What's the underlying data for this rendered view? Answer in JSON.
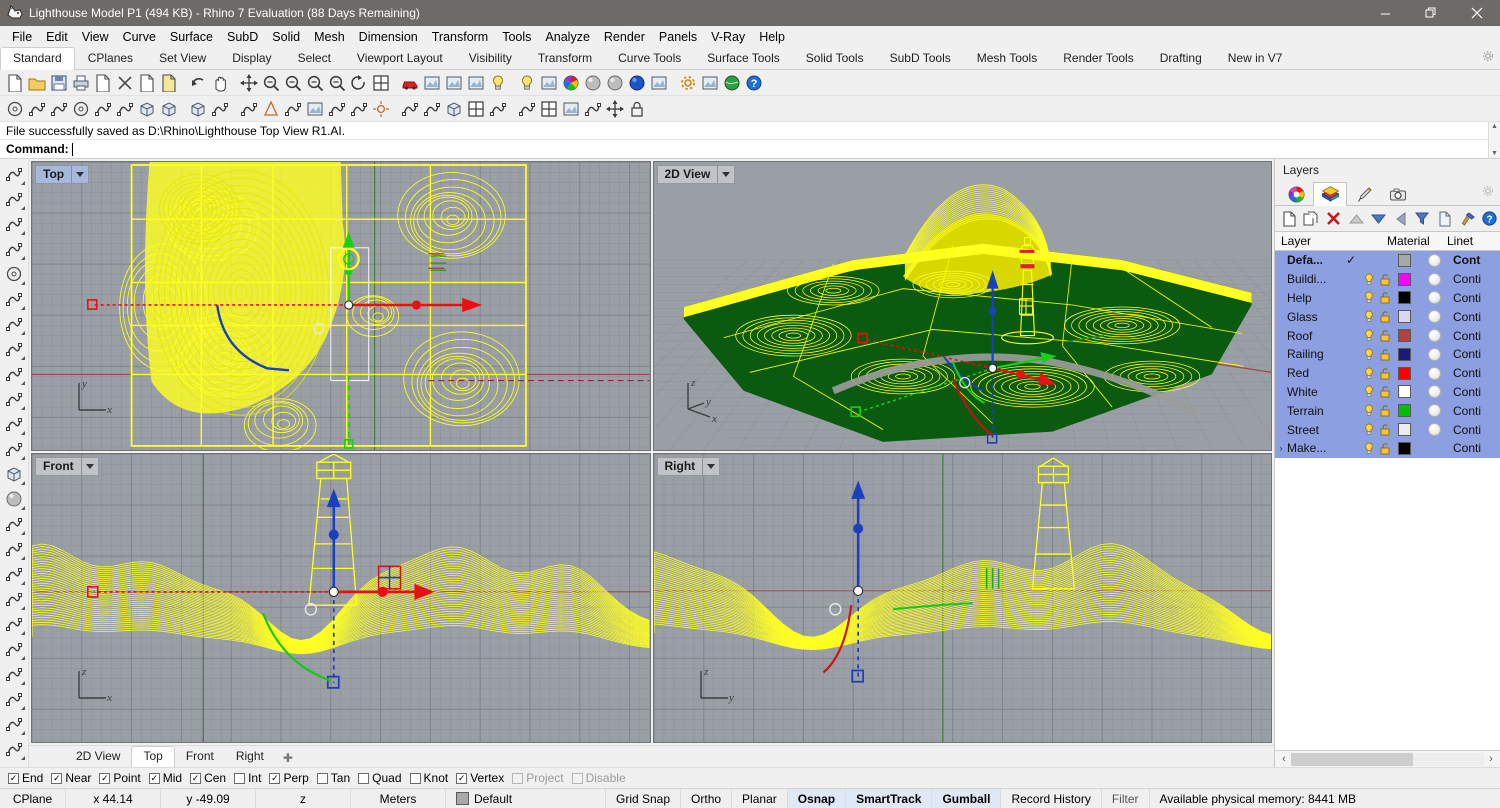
{
  "titlebar": {
    "text": "Lighthouse Model P1 (494 KB) - Rhino 7 Evaluation (88 Days Remaining)",
    "minimize": "—",
    "maximize": "❐",
    "close": "✕",
    "app_icon": "rhino-logo-icon"
  },
  "menu": [
    "File",
    "Edit",
    "View",
    "Curve",
    "Surface",
    "SubD",
    "Solid",
    "Mesh",
    "Dimension",
    "Transform",
    "Tools",
    "Analyze",
    "Render",
    "Panels",
    "V-Ray",
    "Help"
  ],
  "tabs": {
    "items": [
      "Standard",
      "CPlanes",
      "Set View",
      "Display",
      "Select",
      "Viewport Layout",
      "Visibility",
      "Transform",
      "Curve Tools",
      "Surface Tools",
      "Solid Tools",
      "SubD Tools",
      "Mesh Tools",
      "Render Tools",
      "Drafting",
      "New in V7"
    ],
    "active": "Standard"
  },
  "toolbar_row1": [
    "new-file-icon",
    "open-folder-icon",
    "save-icon",
    "print-icon",
    "cut-copy-icon",
    "delete-x-icon",
    "copy-icon",
    "paste-icon",
    "undo-arrow-icon",
    "pan-hand-icon",
    "move-icon",
    "zoom-in-icon",
    "zoom-window-icon",
    "zoom-extents-icon",
    "zoom-selected-icon",
    "rotate-view-icon",
    "four-view-icon",
    "car-render-icon",
    "render-preview-icon",
    "shade-icon",
    "named-view-icon",
    "light-bulb-icon",
    "spotlight-icon",
    "material-paint-icon",
    "color-wheel-icon",
    "sphere-gray-icon",
    "sphere-shaded-icon",
    "sphere-blue-icon",
    "ray-trace-icon",
    "settings-gear-icon",
    "explode-icon",
    "earth-render-icon",
    "help-icon"
  ],
  "toolbar_row2": [
    "curve-circle-icon",
    "curve-spiral-icon",
    "arc-icon",
    "arc-shaded-icon",
    "revolve-icon",
    "sweep-icon",
    "box-front-icon",
    "box-side-icon",
    "box-new-icon",
    "extrude-icon",
    "loft-icon",
    "cone-icon",
    "pipe-icon",
    "explode-star-icon",
    "blend-icon",
    "offset-surface-icon",
    "sun-icon",
    "lines-icon",
    "mesh-icon",
    "box-corner-icon",
    "box-edit-icon",
    "boolean-icon",
    "trim-icon",
    "grid-icon",
    "analyze-icon",
    "section-icon",
    "center-icon",
    "lock-object-icon"
  ],
  "command": {
    "history": "File successfully saved as D:\\Rhino\\Lighthouse Top View R1.AI.",
    "prompt": "Command:",
    "value": ""
  },
  "left_toolbar": [
    "select-arrow-icon",
    "point-icon",
    "polyline-icon",
    "control-point-curve-icon",
    "circle-icon",
    "ellipse-icon",
    "arc-icon",
    "rectangle-icon",
    "polygon-icon",
    "blend-curve-icon",
    "surface-points-icon",
    "surface-curve-icon",
    "box-solid-icon",
    "sphere-solid-icon",
    "mesh-tools-icon",
    "text-icon",
    "dimension-icon",
    "hatch-icon",
    "layer-icon",
    "transform-icon",
    "array-icon",
    "fillet-icon",
    "trim-icon",
    "split-icon",
    "analyze-icon"
  ],
  "viewports": [
    {
      "name": "Top",
      "active": true,
      "axis": [
        "y",
        "x"
      ]
    },
    {
      "name": "2D View",
      "active": false,
      "axis": [
        "z",
        "y",
        "x"
      ]
    },
    {
      "name": "Front",
      "active": false,
      "axis": [
        "z",
        "x"
      ]
    },
    {
      "name": "Right",
      "active": false,
      "axis": [
        "z",
        "y"
      ]
    }
  ],
  "viewport_tabs": {
    "items": [
      "2D View",
      "Top",
      "Front",
      "Right"
    ],
    "active": "Top",
    "add": "✚"
  },
  "layers_panel": {
    "title": "Layers",
    "tabs": [
      "color-wheel-icon",
      "layers-icon",
      "paintbrush-icon",
      "camera-icon"
    ],
    "active_tab_index": 1,
    "gear": "gear-icon",
    "toolbar": [
      "new-layer-icon",
      "duplicate-layer-icon",
      "delete-layer-icon",
      "move-up-icon",
      "move-down-icon",
      "back-arrow-icon",
      "filter-icon",
      "properties-icon",
      "tools-hammer-icon",
      "help-icon"
    ],
    "columns": [
      "Layer",
      "Material",
      "Linet"
    ],
    "rows": [
      {
        "name": "Defa...",
        "current": "✓",
        "bulb": false,
        "lock": false,
        "color": "#a8a8a8",
        "material": true,
        "linetype": "Cont",
        "bold": true,
        "expander": ""
      },
      {
        "name": "Buildi...",
        "current": "",
        "bulb": true,
        "lock": true,
        "color": "#ff00ff",
        "material": true,
        "linetype": "Conti",
        "bold": false,
        "expander": ""
      },
      {
        "name": "Help",
        "current": "",
        "bulb": true,
        "lock": true,
        "color": "#000000",
        "material": true,
        "linetype": "Conti",
        "bold": false,
        "expander": ""
      },
      {
        "name": "Glass",
        "current": "",
        "bulb": true,
        "lock": true,
        "color": "#ddd6f3",
        "material": true,
        "linetype": "Conti",
        "bold": false,
        "expander": ""
      },
      {
        "name": "Roof",
        "current": "",
        "bulb": true,
        "lock": true,
        "color": "#b64040",
        "material": true,
        "linetype": "Conti",
        "bold": false,
        "expander": ""
      },
      {
        "name": "Railing",
        "current": "",
        "bulb": true,
        "lock": true,
        "color": "#1a1a7a",
        "material": true,
        "linetype": "Conti",
        "bold": false,
        "expander": ""
      },
      {
        "name": "Red",
        "current": "",
        "bulb": true,
        "lock": true,
        "color": "#ff0000",
        "material": true,
        "linetype": "Conti",
        "bold": false,
        "expander": ""
      },
      {
        "name": "White",
        "current": "",
        "bulb": true,
        "lock": true,
        "color": "#ffffff",
        "material": true,
        "linetype": "Conti",
        "bold": false,
        "expander": ""
      },
      {
        "name": "Terrain",
        "current": "",
        "bulb": true,
        "lock": true,
        "color": "#00c000",
        "material": true,
        "linetype": "Conti",
        "bold": false,
        "expander": ""
      },
      {
        "name": "Street",
        "current": "",
        "bulb": true,
        "lock": true,
        "color": "#ededed",
        "material": true,
        "linetype": "Conti",
        "bold": false,
        "expander": ""
      },
      {
        "name": "Make...",
        "current": "",
        "bulb": true,
        "lock": true,
        "color": "#000000",
        "material": false,
        "linetype": "Conti",
        "bold": false,
        "expander": "›"
      }
    ],
    "hscroll": {
      "left": "‹",
      "right": "›"
    }
  },
  "osnap": [
    {
      "label": "End",
      "checked": true,
      "enabled": true
    },
    {
      "label": "Near",
      "checked": true,
      "enabled": true
    },
    {
      "label": "Point",
      "checked": true,
      "enabled": true
    },
    {
      "label": "Mid",
      "checked": true,
      "enabled": true
    },
    {
      "label": "Cen",
      "checked": true,
      "enabled": true
    },
    {
      "label": "Int",
      "checked": false,
      "enabled": true
    },
    {
      "label": "Perp",
      "checked": true,
      "enabled": true
    },
    {
      "label": "Tan",
      "checked": false,
      "enabled": true
    },
    {
      "label": "Quad",
      "checked": false,
      "enabled": true
    },
    {
      "label": "Knot",
      "checked": false,
      "enabled": true
    },
    {
      "label": "Vertex",
      "checked": true,
      "enabled": true
    },
    {
      "label": "Project",
      "checked": false,
      "enabled": false
    },
    {
      "label": "Disable",
      "checked": false,
      "enabled": false
    }
  ],
  "statusbar": {
    "cplane": "CPlane",
    "x": "x 44.14",
    "y": "y -49.09",
    "z": "z",
    "units": "Meters",
    "layer": "Default",
    "layer_swatch": "#a8a8a8",
    "toggles": [
      {
        "label": "Grid Snap",
        "on": false
      },
      {
        "label": "Ortho",
        "on": false
      },
      {
        "label": "Planar",
        "on": false
      },
      {
        "label": "Osnap",
        "on": true
      },
      {
        "label": "SmartTrack",
        "on": true
      },
      {
        "label": "Gumball",
        "on": true
      },
      {
        "label": "Record History",
        "on": false
      },
      {
        "label": "Filter",
        "on": false
      }
    ],
    "memory": "Available physical memory: 8441 MB"
  }
}
